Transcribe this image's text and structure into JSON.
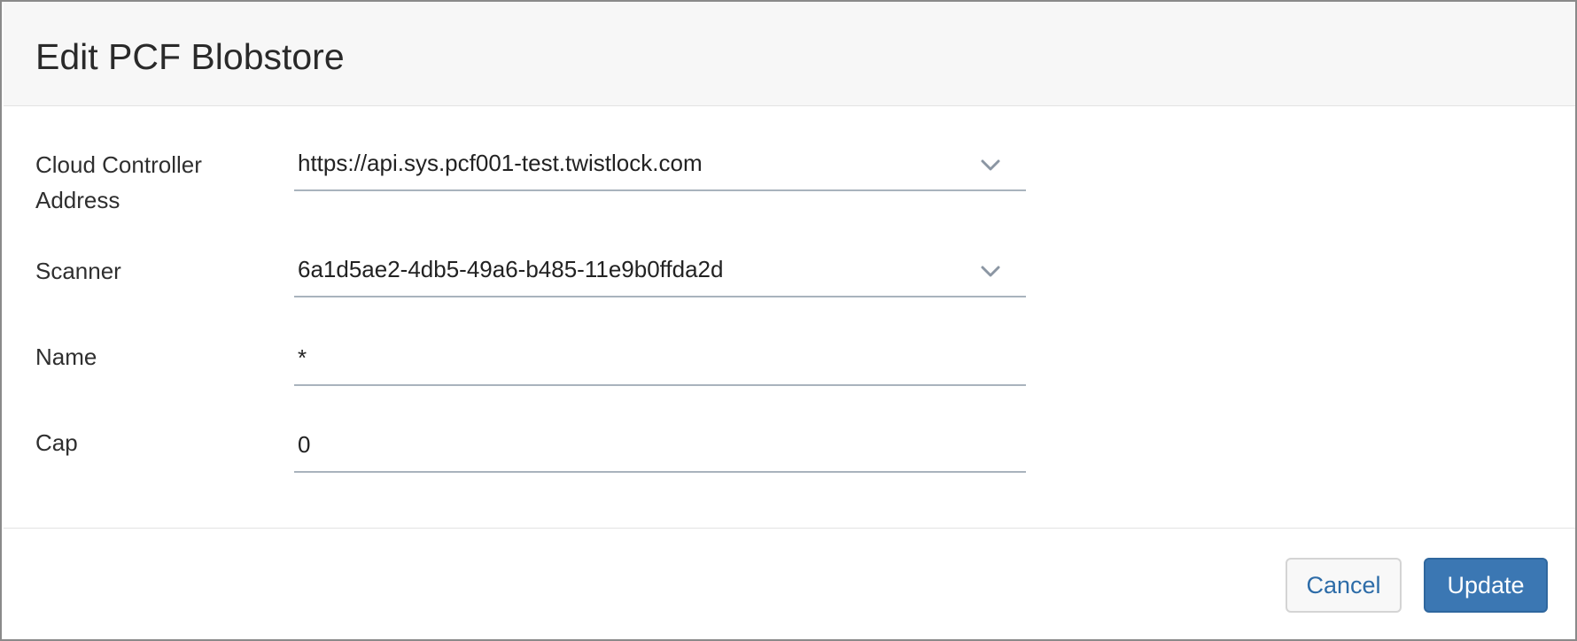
{
  "dialog": {
    "title": "Edit PCF Blobstore"
  },
  "fields": {
    "cloud_controller": {
      "label_line1": "Cloud Controller",
      "label_line2": "Address",
      "value": "https://api.sys.pcf001-test.twistlock.com"
    },
    "scanner": {
      "label": "Scanner",
      "value": "6a1d5ae2-4db5-49a6-b485-11e9b0ffda2d"
    },
    "name": {
      "label": "Name",
      "value": "*"
    },
    "cap": {
      "label": "Cap",
      "value": "0"
    }
  },
  "buttons": {
    "cancel": "Cancel",
    "update": "Update"
  },
  "icons": {
    "dropdown": "chevron-down-icon"
  },
  "colors": {
    "primary": "#3b77b3",
    "link": "#2d6ca8",
    "underline": "#a9b3bd"
  }
}
